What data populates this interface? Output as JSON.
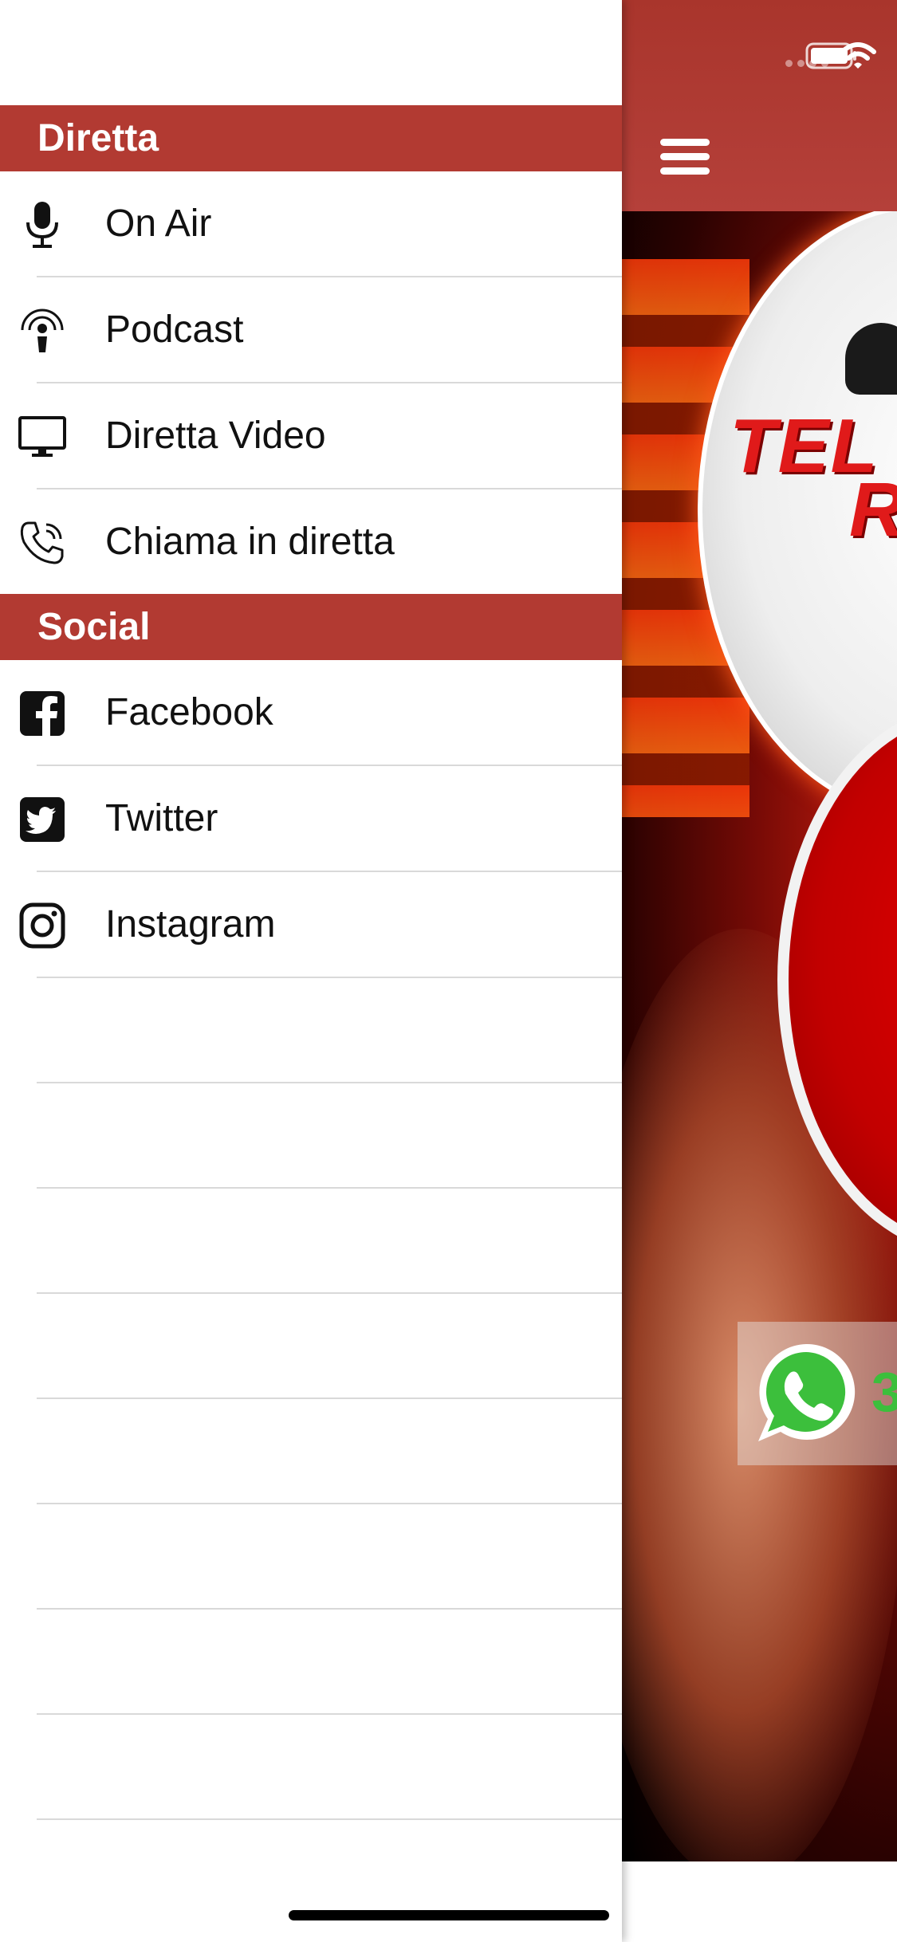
{
  "colors": {
    "accent": "#b23a32",
    "nav_bar": "#ac372e",
    "header_text": "#ffffff",
    "row_text": "#111111",
    "separator": "#d9d9d9",
    "whatsapp_green": "#3cbf3c"
  },
  "drawer": {
    "sections": [
      {
        "title": "Diretta",
        "items": [
          {
            "label": "On Air",
            "icon": "microphone-icon"
          },
          {
            "label": "Podcast",
            "icon": "podcast-icon"
          },
          {
            "label": "Diretta Video",
            "icon": "monitor-icon"
          },
          {
            "label": "Chiama in diretta",
            "icon": "phone-call-icon"
          }
        ]
      },
      {
        "title": "Social",
        "items": [
          {
            "label": "Facebook",
            "icon": "facebook-icon"
          },
          {
            "label": "Twitter",
            "icon": "twitter-icon"
          },
          {
            "label": "Instagram",
            "icon": "instagram-icon"
          }
        ]
      }
    ]
  },
  "main": {
    "nav": {
      "menu_icon": "hamburger-menu-icon"
    },
    "status": {
      "wifi_icon": "wifi-icon",
      "battery_icon": "battery-icon"
    },
    "hero": {
      "logo_text_line1": "TEL",
      "logo_text_line2": "R",
      "whatsapp_icon": "whatsapp-icon",
      "whatsapp_number_visible": "3"
    }
  }
}
